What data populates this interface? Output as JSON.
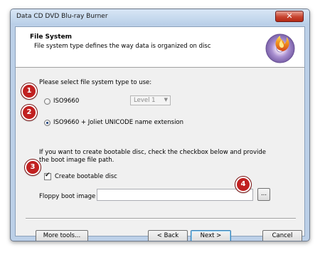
{
  "window": {
    "title": "Data CD DVD Blu-ray Burner",
    "close_glyph": "✕"
  },
  "header": {
    "title": "File System",
    "subtitle": "File system type defines the way data is organized on disc",
    "icon": "disc-burn-icon"
  },
  "prompt": "Please select file system type to use:",
  "options": [
    {
      "label": "ISO9660",
      "selected": false
    },
    {
      "label": "ISO9660 + Joliet UNICODE name extension",
      "selected": true
    }
  ],
  "level_select": {
    "value": "Level 1",
    "enabled": false
  },
  "boot_note": "If you want to create bootable disc, check the checkbox below and provide the boot image file path.",
  "bootable_checkbox": {
    "label": "Create bootable disc",
    "checked": true,
    "check_glyph": "✔"
  },
  "floppy": {
    "label": "Floppy boot image",
    "value": "",
    "browse_label": "..."
  },
  "buttons": {
    "more_tools": "More tools...",
    "back": "< Back",
    "next": "Next >",
    "cancel": "Cancel"
  },
  "callouts": [
    "1",
    "2",
    "3",
    "4"
  ],
  "colors": {
    "callout": "#c12020",
    "title_bar": "#bcd0e8",
    "default_button_border": "#3c7fb1"
  }
}
